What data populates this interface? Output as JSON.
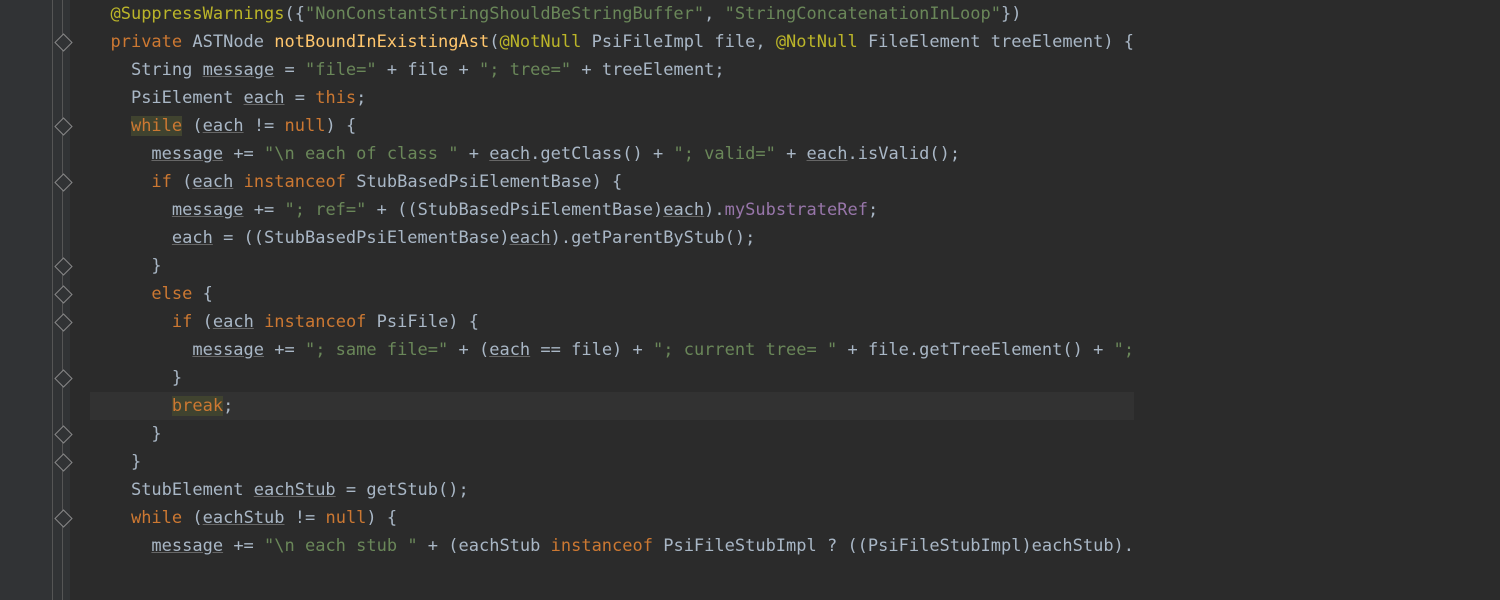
{
  "code": {
    "lines": [
      {
        "indent": 1,
        "tokens": [
          {
            "t": "ann",
            "v": "@SuppressWarnings"
          },
          {
            "t": "p",
            "v": "({"
          },
          {
            "t": "str",
            "v": "\"NonConstantStringShouldBeStringBuffer\""
          },
          {
            "t": "p",
            "v": ", "
          },
          {
            "t": "str",
            "v": "\"StringConcatenationInLoop\""
          },
          {
            "t": "p",
            "v": "})"
          }
        ]
      },
      {
        "indent": 1,
        "tokens": [
          {
            "t": "kw",
            "v": "private "
          },
          {
            "t": "type",
            "v": "ASTNode "
          },
          {
            "t": "method-name",
            "v": "notBoundInExistingAst"
          },
          {
            "t": "p",
            "v": "("
          },
          {
            "t": "ann",
            "v": "@NotNull "
          },
          {
            "t": "type",
            "v": "PsiFileImpl file, "
          },
          {
            "t": "ann",
            "v": "@NotNull "
          },
          {
            "t": "type",
            "v": "FileElement treeElement) {"
          }
        ]
      },
      {
        "indent": 2,
        "tokens": [
          {
            "t": "type",
            "v": "String "
          },
          {
            "t": "underline",
            "v": "message"
          },
          {
            "t": "p",
            "v": " = "
          },
          {
            "t": "str",
            "v": "\"file=\""
          },
          {
            "t": "p",
            "v": " + file + "
          },
          {
            "t": "str",
            "v": "\"; tree=\""
          },
          {
            "t": "p",
            "v": " + treeElement;"
          }
        ]
      },
      {
        "indent": 2,
        "tokens": [
          {
            "t": "type",
            "v": "PsiElement "
          },
          {
            "t": "underline",
            "v": "each"
          },
          {
            "t": "p",
            "v": " = "
          },
          {
            "t": "kw",
            "v": "this"
          },
          {
            "t": "p",
            "v": ";"
          }
        ]
      },
      {
        "indent": 2,
        "tokens": [
          {
            "t": "kw hl-usage",
            "v": "while"
          },
          {
            "t": "p",
            "v": " ("
          },
          {
            "t": "underline",
            "v": "each"
          },
          {
            "t": "p",
            "v": " != "
          },
          {
            "t": "kw",
            "v": "null"
          },
          {
            "t": "p",
            "v": ") {"
          }
        ]
      },
      {
        "indent": 3,
        "tokens": [
          {
            "t": "underline",
            "v": "message"
          },
          {
            "t": "p",
            "v": " += "
          },
          {
            "t": "str",
            "v": "\"\\n each of class \""
          },
          {
            "t": "p",
            "v": " + "
          },
          {
            "t": "underline",
            "v": "each"
          },
          {
            "t": "p",
            "v": ".getClass() + "
          },
          {
            "t": "str",
            "v": "\"; valid=\""
          },
          {
            "t": "p",
            "v": " + "
          },
          {
            "t": "underline",
            "v": "each"
          },
          {
            "t": "p",
            "v": ".isValid();"
          }
        ]
      },
      {
        "indent": 3,
        "tokens": [
          {
            "t": "kw",
            "v": "if "
          },
          {
            "t": "p",
            "v": "("
          },
          {
            "t": "underline",
            "v": "each"
          },
          {
            "t": "p",
            "v": " "
          },
          {
            "t": "kw",
            "v": "instanceof "
          },
          {
            "t": "type",
            "v": "StubBasedPsiElementBase) {"
          }
        ]
      },
      {
        "indent": 4,
        "tokens": [
          {
            "t": "underline",
            "v": "message"
          },
          {
            "t": "p",
            "v": " += "
          },
          {
            "t": "str",
            "v": "\"; ref=\""
          },
          {
            "t": "p",
            "v": " + ((StubBasedPsiElementBase)"
          },
          {
            "t": "underline",
            "v": "each"
          },
          {
            "t": "p",
            "v": ")."
          },
          {
            "t": "field",
            "v": "mySubstrateRef"
          },
          {
            "t": "p",
            "v": ";"
          }
        ]
      },
      {
        "indent": 4,
        "tokens": [
          {
            "t": "underline",
            "v": "each"
          },
          {
            "t": "p",
            "v": " = ((StubBasedPsiElementBase)"
          },
          {
            "t": "underline",
            "v": "each"
          },
          {
            "t": "p",
            "v": ").getParentByStub();"
          }
        ]
      },
      {
        "indent": 3,
        "tokens": [
          {
            "t": "p",
            "v": "}"
          }
        ]
      },
      {
        "indent": 3,
        "tokens": [
          {
            "t": "kw",
            "v": "else "
          },
          {
            "t": "p",
            "v": "{"
          }
        ]
      },
      {
        "indent": 4,
        "tokens": [
          {
            "t": "kw",
            "v": "if "
          },
          {
            "t": "p",
            "v": "("
          },
          {
            "t": "underline",
            "v": "each"
          },
          {
            "t": "p",
            "v": " "
          },
          {
            "t": "kw",
            "v": "instanceof "
          },
          {
            "t": "type",
            "v": "PsiFile) {"
          }
        ]
      },
      {
        "indent": 5,
        "tokens": [
          {
            "t": "underline",
            "v": "message"
          },
          {
            "t": "p",
            "v": " += "
          },
          {
            "t": "str",
            "v": "\"; same file=\""
          },
          {
            "t": "p",
            "v": " + ("
          },
          {
            "t": "underline",
            "v": "each"
          },
          {
            "t": "p",
            "v": " == file) + "
          },
          {
            "t": "str",
            "v": "\"; current tree= \""
          },
          {
            "t": "p",
            "v": " + file.getTreeElement() + "
          },
          {
            "t": "str",
            "v": "\";"
          }
        ]
      },
      {
        "indent": 4,
        "tokens": [
          {
            "t": "p",
            "v": "}"
          }
        ]
      },
      {
        "indent": 4,
        "hl": true,
        "tokens": [
          {
            "t": "kw hl-usage",
            "v": "break"
          },
          {
            "t": "p",
            "v": ";"
          }
        ]
      },
      {
        "indent": 3,
        "tokens": [
          {
            "t": "p",
            "v": "}"
          }
        ]
      },
      {
        "indent": 2,
        "tokens": [
          {
            "t": "p",
            "v": "}"
          }
        ]
      },
      {
        "indent": 2,
        "tokens": [
          {
            "t": "type",
            "v": "StubElement "
          },
          {
            "t": "underline",
            "v": "eachStub"
          },
          {
            "t": "p",
            "v": " = getStub();"
          }
        ]
      },
      {
        "indent": 2,
        "tokens": [
          {
            "t": "kw",
            "v": "while "
          },
          {
            "t": "p",
            "v": "("
          },
          {
            "t": "underline",
            "v": "eachStub"
          },
          {
            "t": "p",
            "v": " != "
          },
          {
            "t": "kw",
            "v": "null"
          },
          {
            "t": "p",
            "v": ") {"
          }
        ]
      },
      {
        "indent": 3,
        "tokens": [
          {
            "t": "underline",
            "v": "message"
          },
          {
            "t": "p",
            "v": " += "
          },
          {
            "t": "str",
            "v": "\"\\n each stub \""
          },
          {
            "t": "p",
            "v": " + (eachStub "
          },
          {
            "t": "kw",
            "v": "instanceof "
          },
          {
            "t": "type",
            "v": "PsiFileStubImpl ? ((PsiFileStubImpl)eachStub)."
          }
        ]
      }
    ]
  },
  "fold_markers": [
    1,
    4,
    6,
    9,
    10,
    11,
    13,
    15,
    16,
    18
  ]
}
